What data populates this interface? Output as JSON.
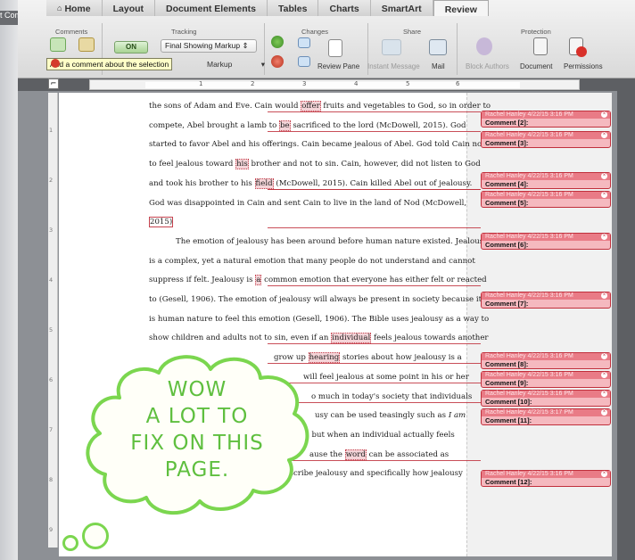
{
  "window": {
    "title_fragment": "t Comm"
  },
  "ribbon": {
    "tabs": [
      {
        "label": "Home",
        "active": false
      },
      {
        "label": "Layout",
        "active": false
      },
      {
        "label": "Document Elements",
        "active": false
      },
      {
        "label": "Tables",
        "active": false
      },
      {
        "label": "Charts",
        "active": false
      },
      {
        "label": "SmartArt",
        "active": false
      },
      {
        "label": "Review",
        "active": true
      }
    ],
    "groups": {
      "comments": "Comments",
      "tracking": "Tracking",
      "changes": "Changes",
      "share": "Share",
      "protection": "Protection"
    },
    "track_toggle": "ON",
    "markup_select": "Final Showing Markup",
    "markup_select_second": "Markup",
    "tooltip": "Add a comment about the selection",
    "buttons": {
      "review_pane": "Review Pane",
      "instant_message": "Instant Message",
      "mail": "Mail",
      "block_authors": "Block Authors",
      "document": "Document",
      "permissions": "Permissions"
    }
  },
  "ruler": {
    "numbers": [
      "1",
      "2",
      "3",
      "4",
      "5",
      "6"
    ]
  },
  "vruler": {
    "numbers": [
      "1",
      "2",
      "3",
      "4",
      "5",
      "6",
      "7",
      "8",
      "9"
    ]
  },
  "document": {
    "lines": [
      {
        "segments": [
          {
            "t": "the sons of Adam and Eve. Cain would "
          },
          {
            "t": "offer",
            "hl": true
          },
          {
            "t": " fruits and vegetables to God, so in order to"
          }
        ]
      },
      {
        "segments": [
          {
            "t": "compete, Abel brought a lamb to "
          },
          {
            "t": "be",
            "hl": true
          },
          {
            "t": " sacrificed to the lord (McDowell, 2015). God"
          }
        ]
      },
      {
        "segments": [
          {
            "t": "started to favor Abel and his offerings. Cain became jealous of Abel. God told Cain not"
          }
        ]
      },
      {
        "segments": [
          {
            "t": "to feel jealous toward "
          },
          {
            "t": "his",
            "hl": true
          },
          {
            "t": " brother and not to sin. Cain, however, did not listen to God"
          }
        ]
      },
      {
        "segments": [
          {
            "t": "and took his brother to his "
          },
          {
            "t": "field",
            "hl": true
          },
          {
            "t": " (McDowell, 2015).  Cain killed Abel out of jealousy."
          }
        ]
      },
      {
        "segments": [
          {
            "t": "God was disappointed in Cain and sent Cain to live in the land of Nod (McDowell,"
          }
        ]
      },
      {
        "segments": [
          {
            "t": "2015)",
            "box": true
          }
        ]
      },
      {
        "indent": true,
        "segments": [
          {
            "t": "The emotion of jealousy has been around before human nature existed. Jealousy"
          }
        ]
      },
      {
        "segments": [
          {
            "t": "is a complex, yet a natural emotion that many people do not understand and cannot"
          }
        ]
      },
      {
        "segments": [
          {
            "t": "suppress if felt. Jealousy is "
          },
          {
            "t": "a",
            "hl": true
          },
          {
            "t": " common emotion that everyone has either felt or reacted"
          }
        ]
      },
      {
        "segments": [
          {
            "t": "to (Gesell, 1906). The emotion of jealousy will always be present in society because it"
          }
        ]
      },
      {
        "segments": [
          {
            "t": "is human nature to feel this emotion (Gesell, 1906). The Bible uses jealousy as a way to"
          }
        ]
      },
      {
        "segments": [
          {
            "t": "show children and adults not to sin, even if an "
          },
          {
            "t": "individual",
            "hl": true
          },
          {
            "t": " feels jealous towards another"
          }
        ]
      },
      {
        "segments": [
          {
            "t": "grow up "
          },
          {
            "t": "hearing",
            "hl": true
          },
          {
            "t": " stories about how jealousy is a"
          }
        ],
        "offset": 140
      },
      {
        "segments": [
          {
            "t": "will feel jealous at some point in his or her"
          }
        ],
        "offset": 173
      },
      {
        "segments": [
          {
            "t": "o much in today's society that individuals"
          }
        ],
        "offset": 182
      },
      {
        "segments": [
          {
            "t": "usy can be used teasingly such as "
          },
          {
            "t": "I am",
            "it": true
          }
        ],
        "offset": 186
      },
      {
        "segments": [
          {
            "t": ", but when an individual actually feels"
          }
        ],
        "offset": 177
      },
      {
        "segments": [
          {
            "t": "ause the "
          },
          {
            "t": "word",
            "hl": true
          },
          {
            "t": " can be associated as"
          }
        ],
        "offset": 180
      },
      {
        "segments": [
          {
            "t": "describe jealousy and specifically how jealousy"
          }
        ],
        "offset": 147
      }
    ]
  },
  "comments": [
    {
      "author": "Rachel Hanley 4/22/15 3:16 PM",
      "label": "Comment [2]:"
    },
    {
      "author": "Rachel Hanley 4/22/15 3:16 PM",
      "label": "Comment [3]:"
    },
    {
      "author": "Rachel Hanley 4/22/15 3:16 PM",
      "label": "Comment [4]:"
    },
    {
      "author": "Rachel Hanley 4/22/15 3:16 PM",
      "label": "Comment [5]:"
    },
    {
      "author": "Rachel Hanley 4/22/15 3:16 PM",
      "label": "Comment [6]:"
    },
    {
      "author": "Rachel Hanley 4/22/15 3:16 PM",
      "label": "Comment [7]:"
    },
    {
      "author": "Rachel Hanley 4/22/15 3:16 PM",
      "label": "Comment [8]:"
    },
    {
      "author": "Rachel Hanley 4/22/15 3:16 PM",
      "label": "Comment [9]:"
    },
    {
      "author": "Rachel Hanley 4/22/15 3:16 PM",
      "label": "Comment [10]:"
    },
    {
      "author": "Rachel Hanley 4/22/15 3:17 PM",
      "label": "Comment [11]:"
    },
    {
      "author": "Rachel Hanley 4/22/15 3:16 PM",
      "label": "Comment [12]:"
    }
  ],
  "annotation": {
    "lines": [
      "WOW",
      "A LOT TO",
      "FIX ON THIS",
      "PAGE."
    ],
    "color": "#5fbf3f"
  },
  "colors": {
    "background": "#e0468c",
    "comment_fill": "#f5b9bf",
    "comment_border": "#c0303c"
  }
}
